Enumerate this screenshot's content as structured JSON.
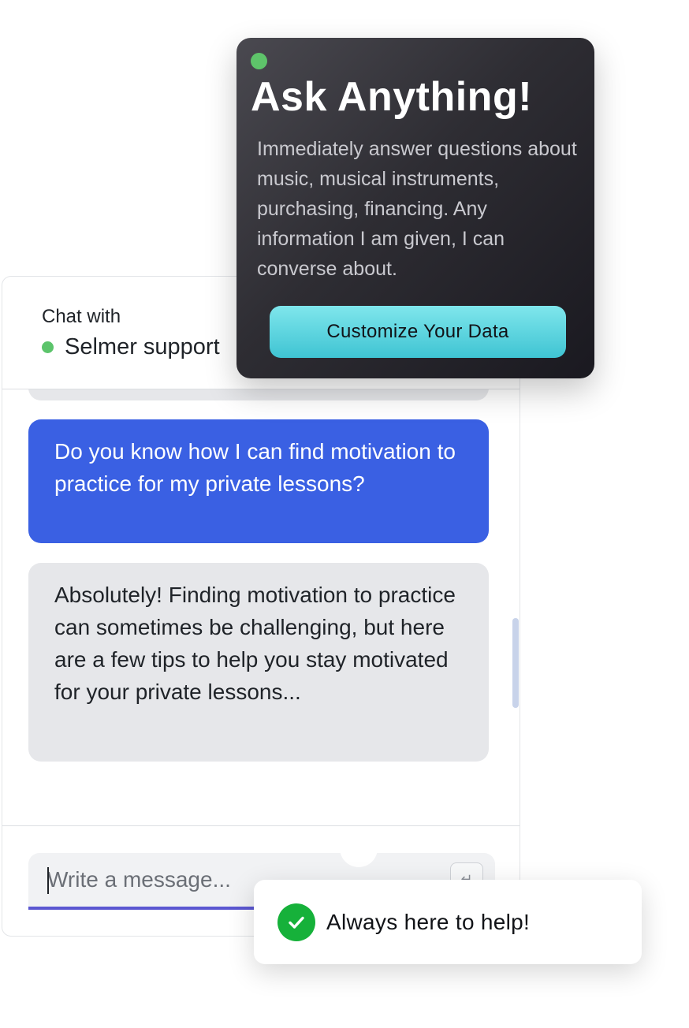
{
  "chat": {
    "header": {
      "chat_with_label": "Chat with",
      "agent_name": "Selmer support",
      "status_color": "#5cc46b"
    },
    "messages": [
      {
        "role": "user",
        "text": "Do you know how I can find motivation to practice for my private lessons?"
      },
      {
        "role": "assistant",
        "text": "Absolutely! Finding motivation to practice can sometimes be challenging, but here are a few tips to help you stay motivated for your private lessons..."
      }
    ],
    "input": {
      "placeholder": "Write a message...",
      "value": ""
    },
    "send_icon": "send-icon",
    "colors": {
      "user_bubble": "#3a60e3",
      "assistant_bubble": "#e6e7ea",
      "input_underline": "#5b57d1"
    }
  },
  "feature_card": {
    "title": "Ask Anything!",
    "description": "Immediately answer questions about music, musical instruments, purchasing, financing. Any information I am given, I can converse about.",
    "button_label": "Customize Your Data",
    "status_color": "#5ec46a",
    "button_color": "#5fd6e0"
  },
  "toast": {
    "text": "Always here to help!",
    "icon": "check-icon",
    "icon_color": "#16b13a"
  }
}
